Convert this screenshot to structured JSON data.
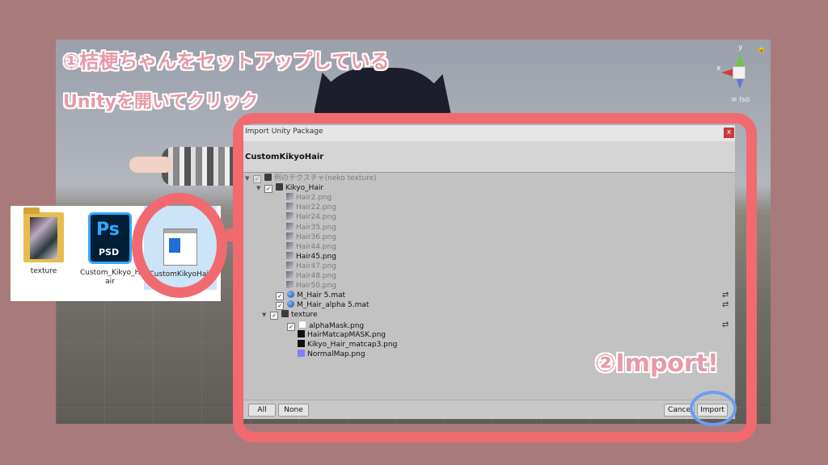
{
  "overlay": {
    "step1_line1": "①桔梗ちゃんをセットアップしている",
    "step1_line2": "Unityを開いてクリック",
    "step2": "②Import!"
  },
  "scene": {
    "gizmo": {
      "x_label": "x",
      "y_label": "y",
      "view_mode": "≡ Iso",
      "lock": "🔒"
    }
  },
  "explorer": {
    "files": [
      {
        "name": "texture",
        "icon": "folder-icon"
      },
      {
        "name": "Custom_Kikyo_H air",
        "icon": "photoshop-psd-icon",
        "ps": "Ps",
        "ext": "PSD"
      },
      {
        "name": "CustomKikyoHair",
        "icon": "unity-package-icon"
      }
    ]
  },
  "dialog": {
    "title": "Import Unity Package",
    "close": "x",
    "package_name": "CustomKikyoHair",
    "tree": [
      {
        "label": "例のテクスチャ(neko texture)",
        "indent": 0,
        "arrow": "▼",
        "checked": true,
        "dim": true,
        "icon": "folder"
      },
      {
        "label": "Kikyo_Hair",
        "indent": 1,
        "arrow": "▼",
        "checked": true,
        "dim": false,
        "icon": "folder"
      },
      {
        "label": "Hair2.png",
        "indent": 2,
        "checked": null,
        "dim": true,
        "icon": "png"
      },
      {
        "label": "Hair22.png",
        "indent": 2,
        "checked": null,
        "dim": true,
        "icon": "png"
      },
      {
        "label": "Hair24.png",
        "indent": 2,
        "checked": null,
        "dim": true,
        "icon": "png"
      },
      {
        "label": "Hair35.png",
        "indent": 2,
        "checked": null,
        "dim": true,
        "icon": "png"
      },
      {
        "label": "Hair36.png",
        "indent": 2,
        "checked": null,
        "dim": true,
        "icon": "png"
      },
      {
        "label": "Hair44.png",
        "indent": 2,
        "checked": null,
        "dim": true,
        "icon": "png"
      },
      {
        "label": "Hair45.png",
        "indent": 2,
        "checked": null,
        "dim": false,
        "icon": "png"
      },
      {
        "label": "Hair47.png",
        "indent": 2,
        "checked": null,
        "dim": true,
        "icon": "png"
      },
      {
        "label": "Hair48.png",
        "indent": 2,
        "checked": null,
        "dim": true,
        "icon": "png"
      },
      {
        "label": "Hair50.png",
        "indent": 2,
        "checked": null,
        "dim": true,
        "icon": "png"
      },
      {
        "label": "M_Hair 5.mat",
        "indent": 2,
        "checked": true,
        "dim": false,
        "icon": "mat",
        "reimport": true
      },
      {
        "label": "M_Hair_alpha 5.mat",
        "indent": 2,
        "checked": true,
        "dim": false,
        "icon": "mat",
        "reimport": true
      },
      {
        "label": "texture",
        "indent": 1.5,
        "arrow": "▼",
        "checked": true,
        "dim": false,
        "icon": "folder"
      },
      {
        "label": "alphaMask.png",
        "indent": 3,
        "checked": true,
        "dim": false,
        "icon": "white",
        "reimport": true
      },
      {
        "label": "HairMatcapMASK.png",
        "indent": 3,
        "checked": null,
        "dim": false,
        "icon": "black"
      },
      {
        "label": "Kikyo_Hair_matcap3.png",
        "indent": 3,
        "checked": null,
        "dim": false,
        "icon": "black"
      },
      {
        "label": "NormalMap.png",
        "indent": 3,
        "checked": null,
        "dim": false,
        "icon": "normal"
      }
    ],
    "reimport_glyph": "⇄",
    "check_glyph": "✓",
    "buttons": {
      "all": "All",
      "none": "None",
      "cancel": "Cance",
      "import": "Import"
    }
  },
  "colors": {
    "annotation_pink": "#f06a6f",
    "annotation_blue": "#6a9ef0",
    "overlay_text": "#e79aa8"
  }
}
